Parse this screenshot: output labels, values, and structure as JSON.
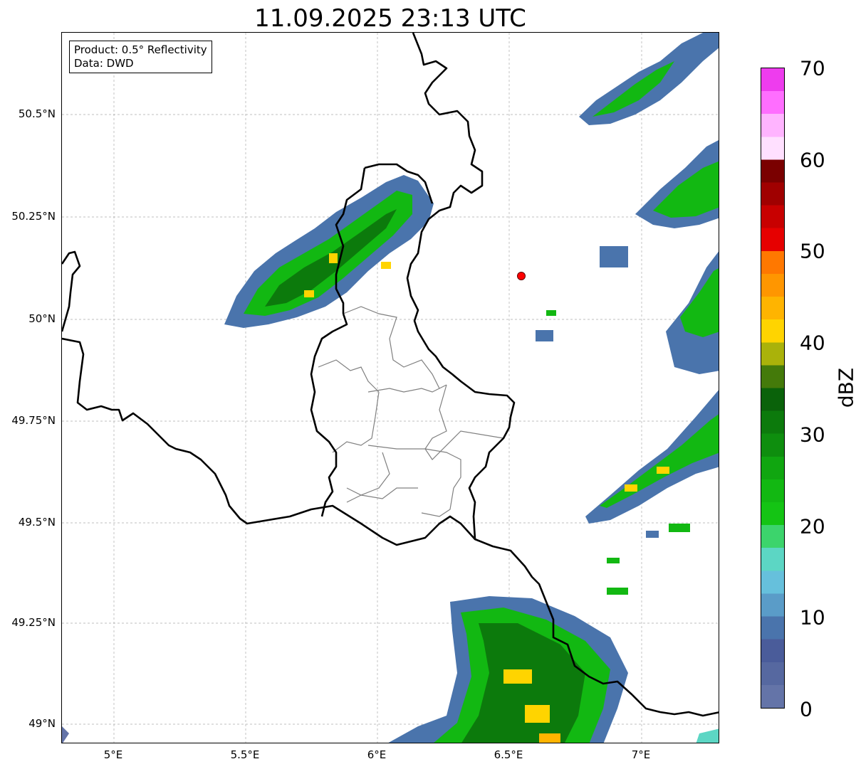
{
  "title": "11.09.2025 23:13 UTC",
  "info": {
    "product": "Product: 0.5° Reflectivity",
    "data": "Data: DWD"
  },
  "latitude_ticks": [
    "50.5°N",
    "50.25°N",
    "50°N",
    "49.75°N",
    "49.5°N",
    "49.25°N",
    "49°N"
  ],
  "longitude_ticks": [
    "5°E",
    "5.5°E",
    "6°E",
    "6.5°E",
    "7°E"
  ],
  "colorbar": {
    "label": "dBZ",
    "ticks": [
      "70",
      "60",
      "50",
      "40",
      "30",
      "20",
      "10",
      "0"
    ],
    "colors": [
      "#6474a8",
      "#5668a0",
      "#4a5c9a",
      "#4a74ac",
      "#5a9cc8",
      "#66c0dc",
      "#5cd6c4",
      "#3cd46c",
      "#14c414",
      "#12b812",
      "#10a610",
      "#0e8e0e",
      "#0c7a0c",
      "#0a620a",
      "#447a0a",
      "#aab20a",
      "#ffd400",
      "#ffb400",
      "#ff9600",
      "#ff7800",
      "#e60000",
      "#c80000",
      "#a00000",
      "#7a0000",
      "#ffe0ff",
      "#ffb4ff",
      "#ff6eff",
      "#ee3cee"
    ]
  },
  "radar_marker": {
    "lon": 6.55,
    "lat": 50.11,
    "color": "#ff0000"
  }
}
